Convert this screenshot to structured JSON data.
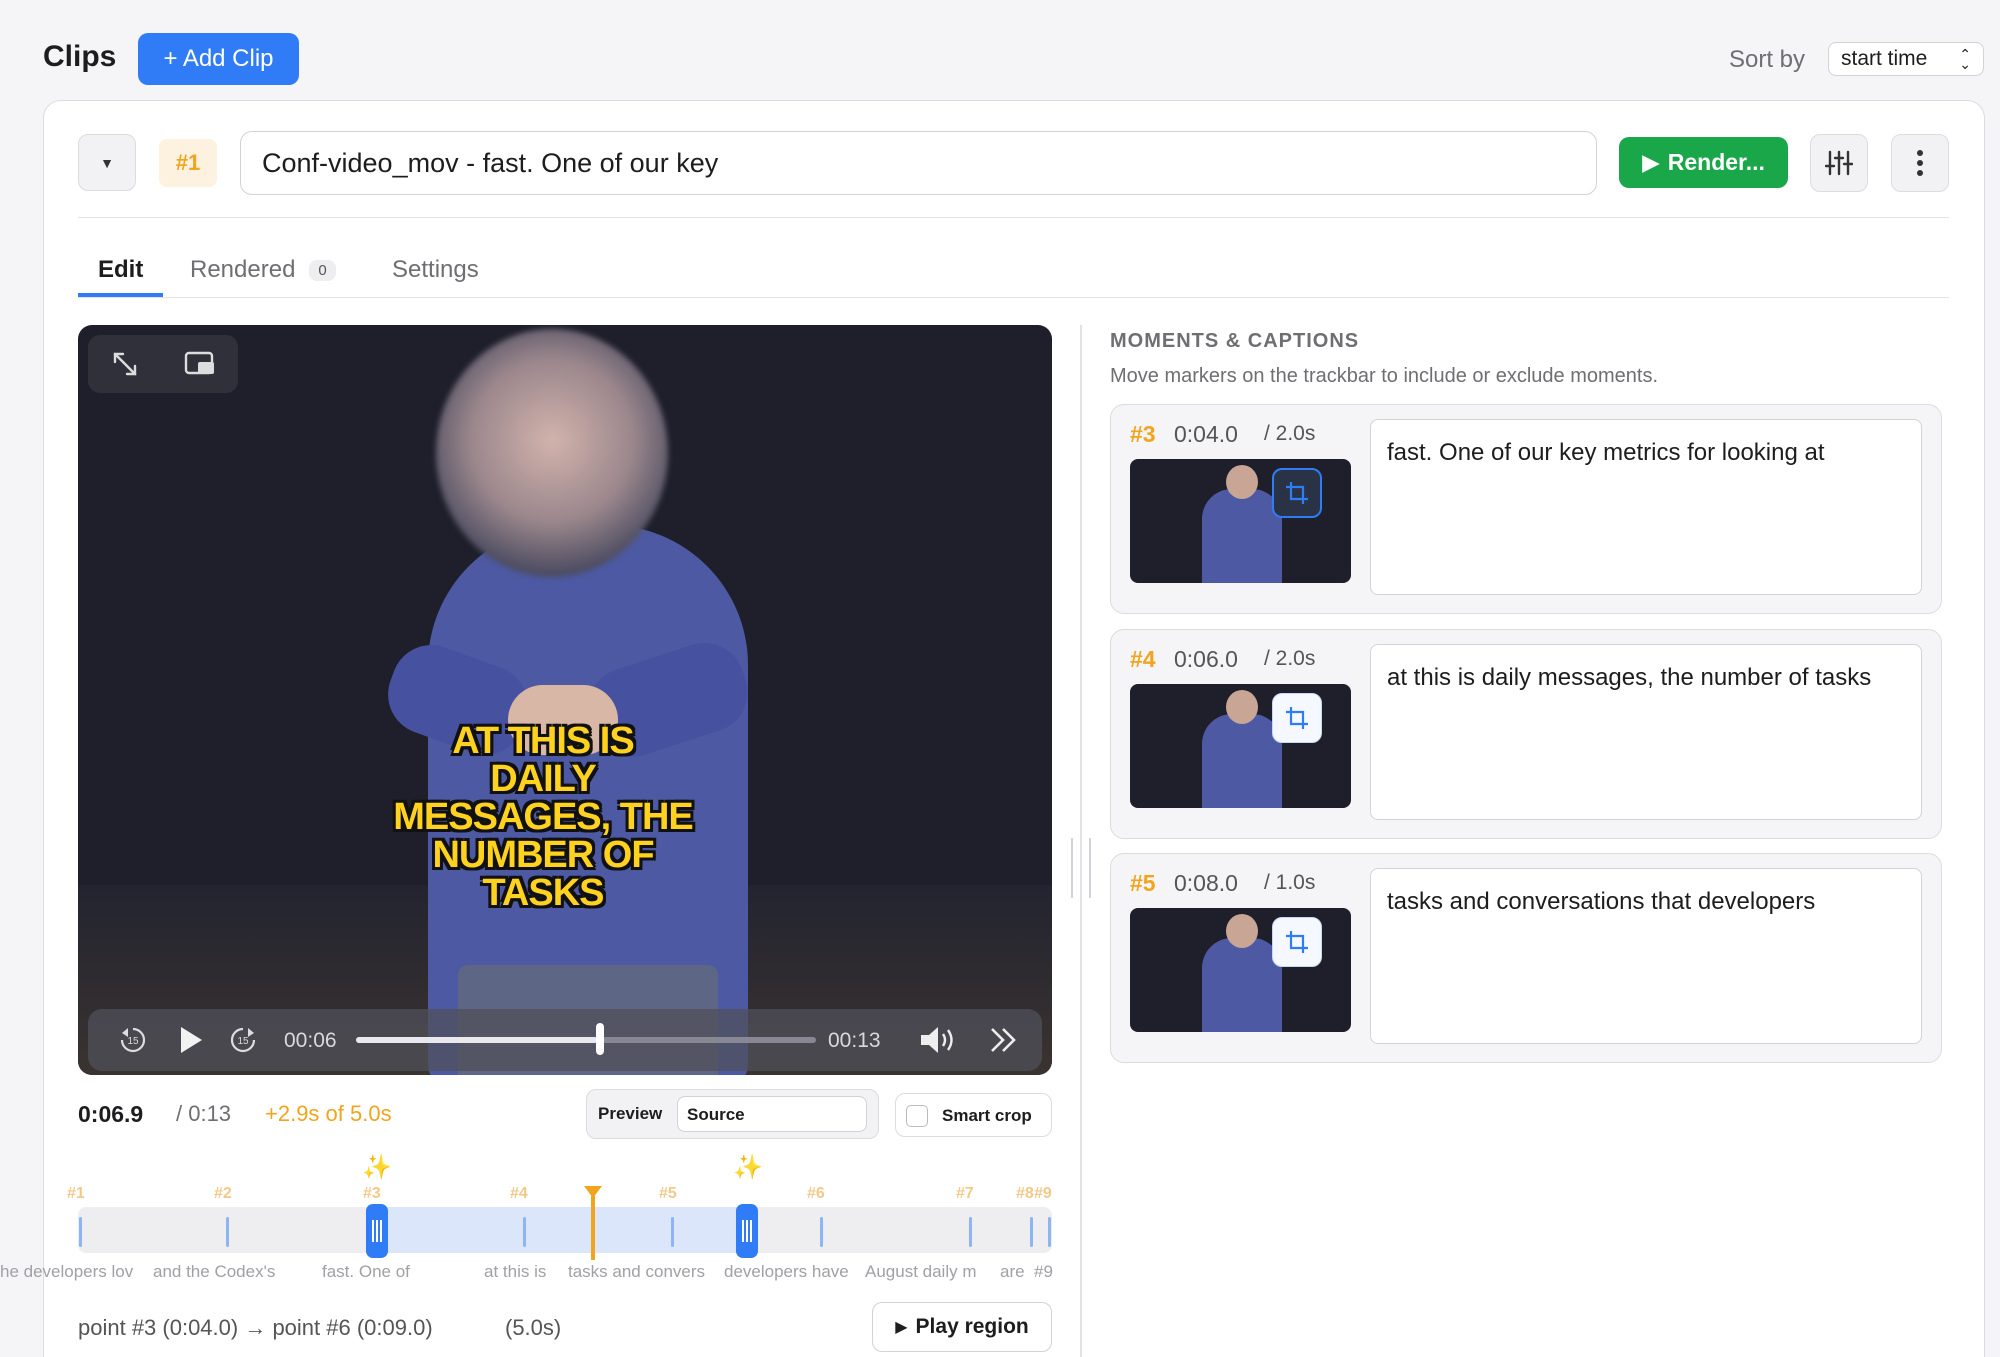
{
  "header": {
    "title": "Clips",
    "add_clip_label": "+ Add Clip",
    "sort_label": "Sort by",
    "sort_value": "start time"
  },
  "clip": {
    "number": "#1",
    "name": "Conf-video_mov - fast. One of our key",
    "render_label": "Render...",
    "accent_color": "#2f7cf6",
    "render_color": "#1aa74a",
    "highlight_color": "#f2a41c"
  },
  "tabs": [
    {
      "label": "Edit",
      "active": true
    },
    {
      "label": "Rendered",
      "count": "0"
    },
    {
      "label": "Settings"
    }
  ],
  "video": {
    "caption_lines": [
      "AT THIS IS",
      "DAILY",
      "MESSAGES, THE",
      "NUMBER OF",
      "TASKS"
    ],
    "current_time": "00:06",
    "duration": "00:13",
    "progress": 0.53,
    "icons": [
      "expand-icon",
      "picture-in-picture-icon",
      "rewind-15-icon",
      "play-icon",
      "forward-15-icon",
      "volume-icon",
      "fast-forward-icon"
    ]
  },
  "playback": {
    "time_now": "0:06.9",
    "time_total": "/ 0:13",
    "delta": "+2.9s of 5.0s",
    "preview_label": "Preview",
    "preview_value": "Source",
    "smart_crop_label": "Smart crop"
  },
  "trackbar": {
    "markers": [
      {
        "label": "#1",
        "word": "he developers lov"
      },
      {
        "label": "#2",
        "word": "and the Codex's"
      },
      {
        "label": "#3",
        "word": "fast. One of"
      },
      {
        "label": "#4",
        "word": "at this is"
      },
      {
        "label": "#5",
        "word": "tasks and convers"
      },
      {
        "label": "#6",
        "word": "developers have"
      },
      {
        "label": "#7",
        "word": "August daily m"
      },
      {
        "label": "#8",
        "word": "are"
      },
      {
        "label": "#9",
        "word": "#9"
      }
    ],
    "region_text": "point #3 (0:04.0) → point #6 (0:09.0)",
    "region_length": "(5.0s)",
    "play_region_label": "Play region"
  },
  "moments": {
    "title": "MOMENTS & CAPTIONS",
    "subtitle": "Move markers on the trackbar to include or exclude moments.",
    "items": [
      {
        "num": "#3",
        "time": "0:04.0",
        "dur": "/ 2.0s",
        "text": "fast. One of our key metrics for looking at"
      },
      {
        "num": "#4",
        "time": "0:06.0",
        "dur": "/ 2.0s",
        "text": "at this is daily messages, the number of tasks"
      },
      {
        "num": "#5",
        "time": "0:08.0",
        "dur": "/ 1.0s",
        "text": "tasks and conversations that developers"
      }
    ]
  }
}
